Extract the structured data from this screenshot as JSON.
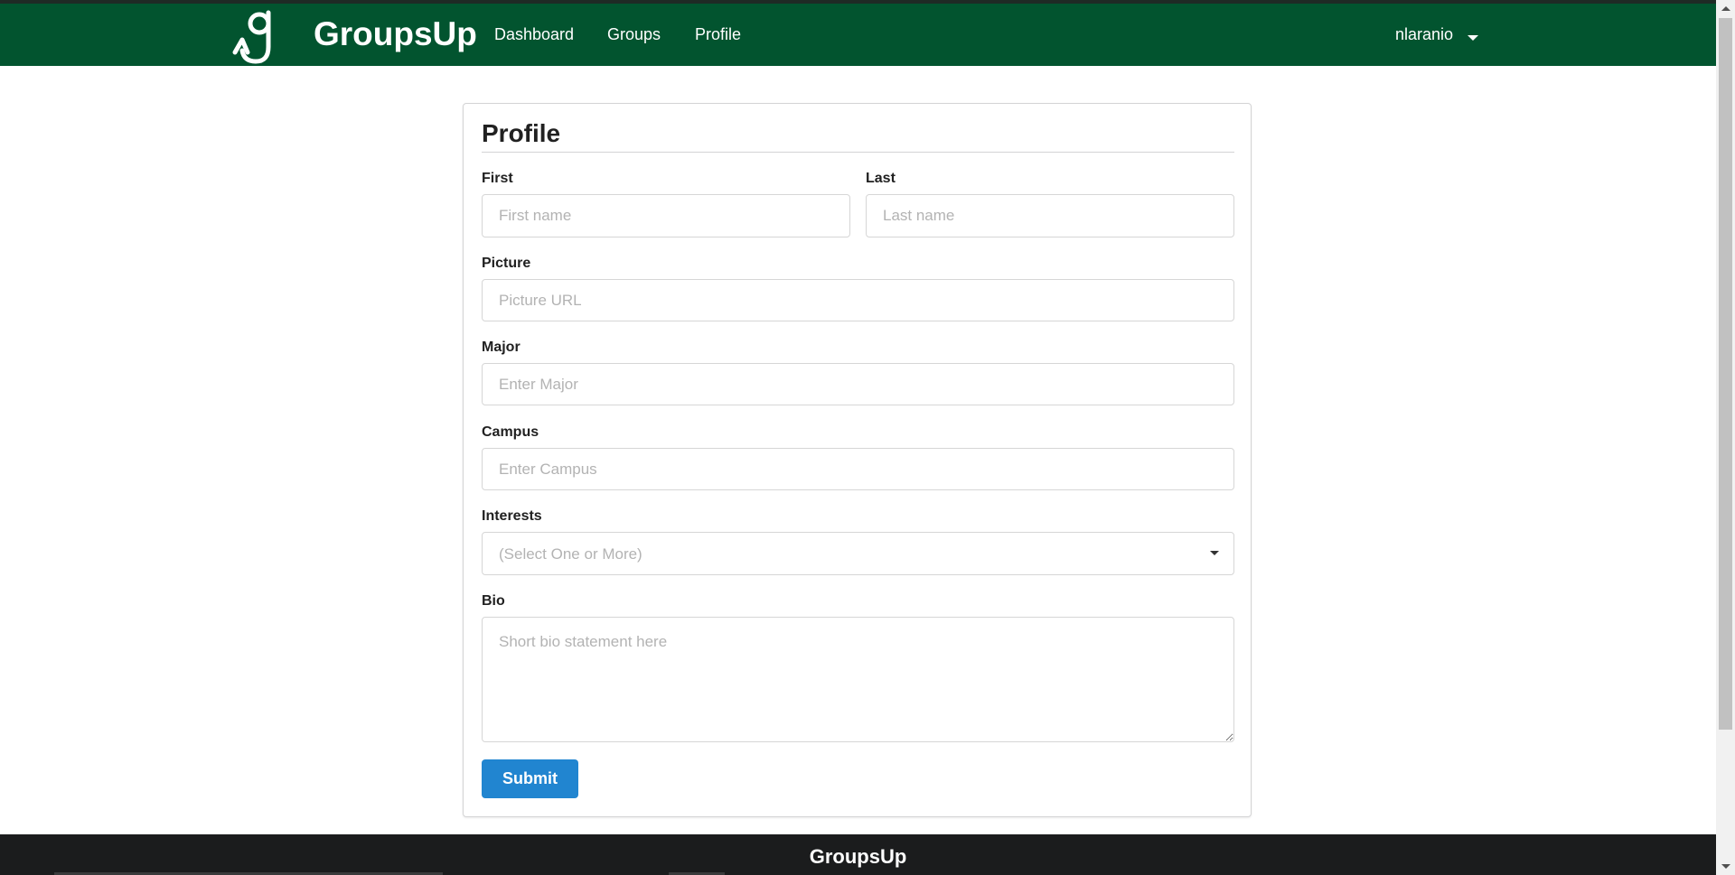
{
  "navbar": {
    "brand": "GroupsUp",
    "logo_icon": "groupsup-g-logo-icon",
    "links": {
      "dashboard": "Dashboard",
      "groups": "Groups",
      "profile": "Profile"
    },
    "user": "nlaranio",
    "user_caret_icon": "caret-down-icon"
  },
  "form": {
    "title": "Profile",
    "first": {
      "label": "First",
      "placeholder": "First name",
      "value": ""
    },
    "last": {
      "label": "Last",
      "placeholder": "Last name",
      "value": ""
    },
    "picture": {
      "label": "Picture",
      "placeholder": "Picture URL",
      "value": ""
    },
    "major": {
      "label": "Major",
      "placeholder": "Enter Major",
      "value": ""
    },
    "campus": {
      "label": "Campus",
      "placeholder": "Enter Campus",
      "value": ""
    },
    "interests": {
      "label": "Interests",
      "placeholder": "(Select One or More)",
      "caret_icon": "dropdown-caret-icon"
    },
    "bio": {
      "label": "Bio",
      "placeholder": "Short bio statement here",
      "value": ""
    },
    "submit_label": "Submit"
  },
  "footer": {
    "text": "GroupsUp"
  },
  "colors": {
    "navbar_bg": "#02542f",
    "submit_bg": "#2185d0",
    "footer_bg": "#1b1c1d"
  }
}
